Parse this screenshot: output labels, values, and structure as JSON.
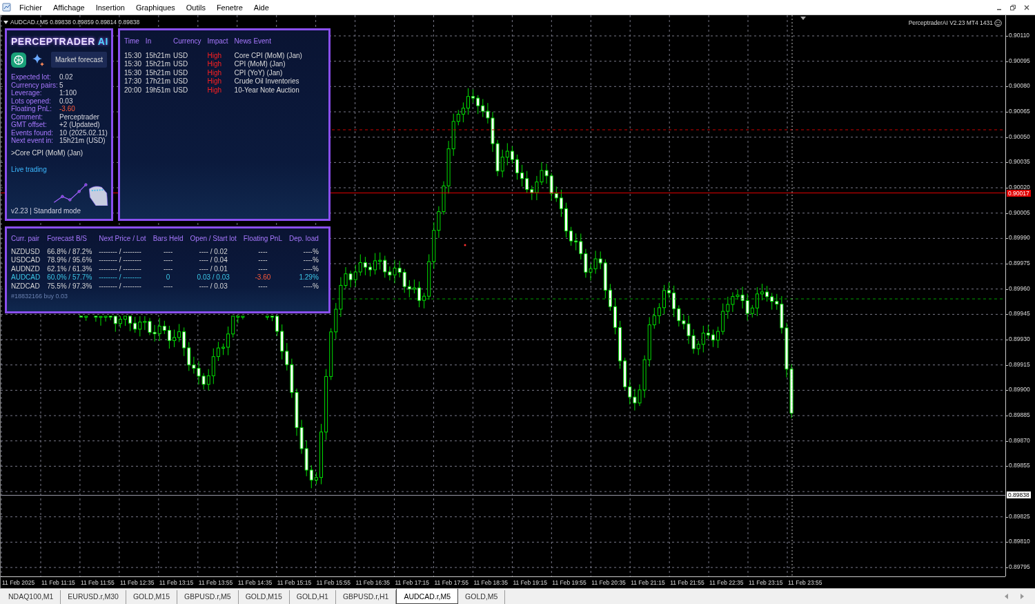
{
  "menu": [
    "Fichier",
    "Affichage",
    "Insertion",
    "Graphiques",
    "Outils",
    "Fenetre",
    "Aide"
  ],
  "chart": {
    "header": "AUDCAD.r,M5  0.89838 0.89859 0.89814 0.89838",
    "ea_label": "PerceptraderAI V2.23 MT4 1431",
    "price_labels": [
      "0.90110",
      "0.90095",
      "0.90080",
      "0.90065",
      "0.90050",
      "0.90035",
      "0.90020",
      "0.90005",
      "0.89990",
      "0.89975",
      "0.89960",
      "0.89945",
      "0.89930",
      "0.89915",
      "0.89900",
      "0.89885",
      "0.89870",
      "0.89855",
      "0.89825",
      "0.89810",
      "0.89795"
    ],
    "time_labels": [
      "11 Feb 2025",
      "11 Feb 11:15",
      "11 Feb 11:55",
      "11 Feb 12:35",
      "11 Feb 13:15",
      "11 Feb 13:55",
      "11 Feb 14:35",
      "11 Feb 15:15",
      "11 Feb 15:55",
      "11 Feb 16:35",
      "11 Feb 17:15",
      "11 Feb 17:55",
      "11 Feb 18:35",
      "11 Feb 19:15",
      "11 Feb 19:55",
      "11 Feb 20:35",
      "11 Feb 21:15",
      "11 Feb 21:55",
      "11 Feb 22:35",
      "11 Feb 23:15",
      "11 Feb 23:55"
    ],
    "price_markers": [
      {
        "kind": "order",
        "label": "0.90017"
      },
      {
        "kind": "bid",
        "label": "0.89838"
      }
    ]
  },
  "info_panel": {
    "title": "PERCEPTRADER",
    "title_accent": "AI",
    "forecast_button": "Market forecast",
    "rows": [
      {
        "label": "Expected lot:",
        "value": "0.02",
        "kind": "normal"
      },
      {
        "label": "Currency pairs:",
        "value": "5",
        "kind": "normal"
      },
      {
        "label": "Leverage:",
        "value": "1:100",
        "kind": "normal"
      },
      {
        "label": "Lots opened:",
        "value": "0.03",
        "kind": "normal"
      },
      {
        "label": "Floating PnL:",
        "value": "-3.60",
        "kind": "loss"
      },
      {
        "label": "Comment:",
        "value": "Perceptrader",
        "kind": "normal"
      },
      {
        "label": "GMT offset:",
        "value": "+2 (Updated)",
        "kind": "normal"
      },
      {
        "label": "Events found:",
        "value": "10 (2025.02.11)",
        "kind": "normal"
      },
      {
        "label": "Next event in:",
        "value": "15h21m (USD)",
        "kind": "normal"
      }
    ],
    "next_event": ">Core CPI (MoM) (Jan)",
    "live_link": "Live trading",
    "footer": "v2.23 | Standard mode"
  },
  "news": {
    "columns": [
      "Time",
      "In",
      "Currency",
      "Impact",
      "News Event"
    ],
    "rows": [
      [
        "15:30",
        "15h21m",
        "USD",
        "High",
        "Core CPI (MoM) (Jan)"
      ],
      [
        "15:30",
        "15h21m",
        "USD",
        "High",
        "CPI (MoM) (Jan)"
      ],
      [
        "15:30",
        "15h21m",
        "USD",
        "High",
        "CPI (YoY) (Jan)"
      ],
      [
        "17:30",
        "17h21m",
        "USD",
        "High",
        "Crude Oil Inventories"
      ],
      [
        "20:00",
        "19h51m",
        "USD",
        "High",
        "10-Year Note Auction"
      ]
    ]
  },
  "pairs": {
    "columns": [
      "Curr. pair",
      "Forecast B/S",
      "Next Price / Lot",
      "Bars Held",
      "Open / Start lot",
      "Floating PnL",
      "Dep. load"
    ],
    "rows": [
      {
        "cells": [
          "NZDUSD",
          "66.8% / 87.2%",
          "-------- / --------",
          "----",
          "---- / 0.02",
          "----",
          "----%"
        ],
        "selected": false,
        "loss": false
      },
      {
        "cells": [
          "USDCAD",
          "78.9% / 95.6%",
          "-------- / --------",
          "----",
          "---- / 0.04",
          "----",
          "----%"
        ],
        "selected": false,
        "loss": false
      },
      {
        "cells": [
          "AUDNZD",
          "62.1% / 61.3%",
          "-------- / --------",
          "----",
          "---- / 0.01",
          "----",
          "----%"
        ],
        "selected": false,
        "loss": false
      },
      {
        "cells": [
          "AUDCAD",
          "60.0% / 57.7%",
          "-------- / --------",
          "0",
          "0.03 / 0.03",
          "-3.60",
          "1.29%"
        ],
        "selected": true,
        "loss": true
      },
      {
        "cells": [
          "NZDCAD",
          "75.5% / 97.3%",
          "-------- / --------",
          "----",
          "---- / 0.03",
          "----",
          "----%"
        ],
        "selected": false,
        "loss": false
      }
    ],
    "order_note": "#18832166 buy 0.03"
  },
  "tabs": [
    {
      "label": "NDAQ100,M1",
      "selected": false
    },
    {
      "label": "EURUSD.r,M30",
      "selected": false
    },
    {
      "label": "GOLD,M15",
      "selected": false
    },
    {
      "label": "GBPUSD.r,M5",
      "selected": false
    },
    {
      "label": "GOLD,M15",
      "selected": false
    },
    {
      "label": "GOLD,H1",
      "selected": false
    },
    {
      "label": "GBPUSD.r,H1",
      "selected": false
    },
    {
      "label": "AUDCAD.r,M5",
      "selected": true
    },
    {
      "label": "GOLD,M5",
      "selected": false
    }
  ]
}
